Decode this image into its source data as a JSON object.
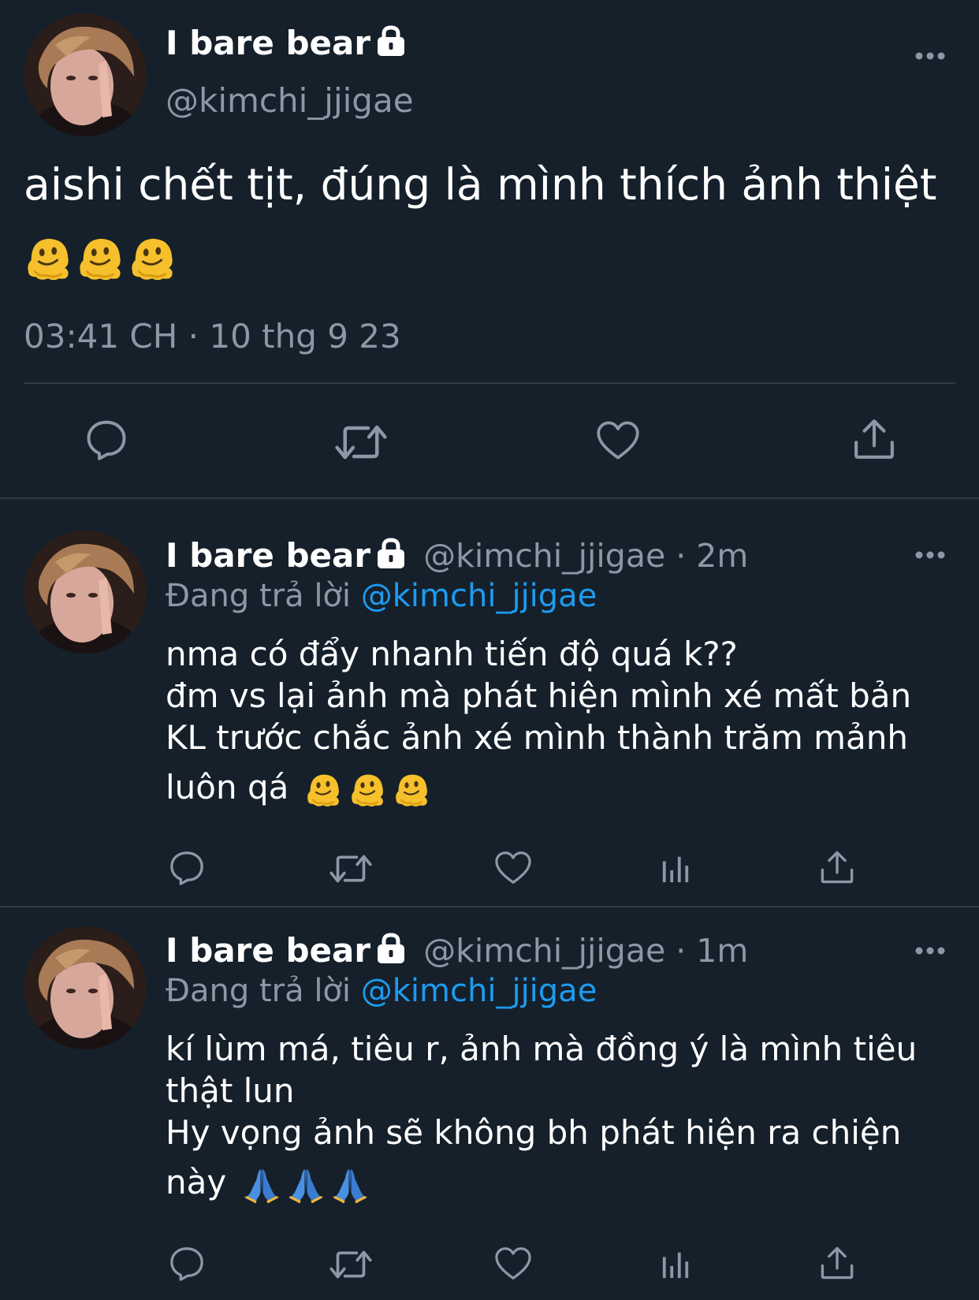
{
  "main_tweet": {
    "display_name": "I bare bear",
    "handle": "@kimchi_jjigae",
    "text": "aishi chết tịt, đúng là mình thích ảnh thiệt",
    "emoji": [
      "melting-face",
      "melting-face",
      "melting-face"
    ],
    "timestamp": "03:41 CH · 10 thg 9 23"
  },
  "replies": [
    {
      "display_name": "I bare bear",
      "handle_time": "@kimchi_jjigae · 2m",
      "replying_label": "Đang trả lời",
      "replying_to": "@kimchi_jjigae",
      "lines": [
        "nma có đẩy nhanh tiến độ quá k??",
        "đm vs lại ảnh mà phát hiện mình xé mất bản",
        "KL trước chắc ảnh xé mình thành trăm mảnh",
        "luôn qá"
      ],
      "emoji": [
        "melting-face",
        "melting-face",
        "melting-face"
      ]
    },
    {
      "display_name": "I bare bear",
      "handle_time": "@kimchi_jjigae · 1m",
      "replying_label": "Đang trả lời",
      "replying_to": "@kimchi_jjigae",
      "lines": [
        "kí lùm má, tiêu r, ảnh mà đồng ý là mình tiêu",
        "thật lun",
        "Hy vọng ảnh sẽ không bh phát hiện ra chiện",
        "này"
      ],
      "emoji": [
        "folded-hands",
        "folded-hands",
        "folded-hands"
      ]
    }
  ],
  "colors": {
    "background": "#15202b",
    "text_primary": "#ffffff",
    "text_secondary": "#8b98a5",
    "link": "#1d9bf0",
    "divider": "#2f3b47"
  }
}
